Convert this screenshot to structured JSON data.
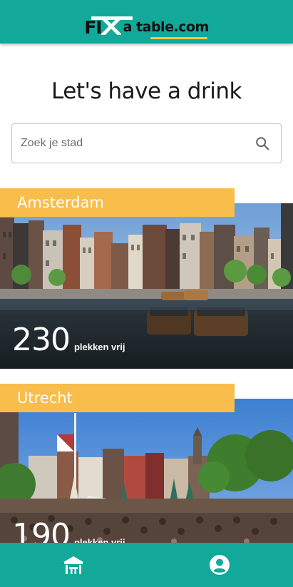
{
  "header": {
    "logo_part1": "FI",
    "logo_part2": "X",
    "logo_part3": "a table.com"
  },
  "page": {
    "title": "Let's have a drink"
  },
  "search": {
    "placeholder": "Zoek je stad",
    "icon": "search-icon"
  },
  "cities": [
    {
      "name": "Amsterdam",
      "count": "230",
      "count_label": "plekken vrij"
    },
    {
      "name": "Utrecht",
      "count": "190",
      "count_label": "plekken vrij"
    }
  ],
  "nav": {
    "items": [
      {
        "icon": "tables-icon"
      },
      {
        "icon": "account-icon"
      }
    ]
  },
  "colors": {
    "primary": "#12a89a",
    "accent": "#f9bd4b"
  }
}
